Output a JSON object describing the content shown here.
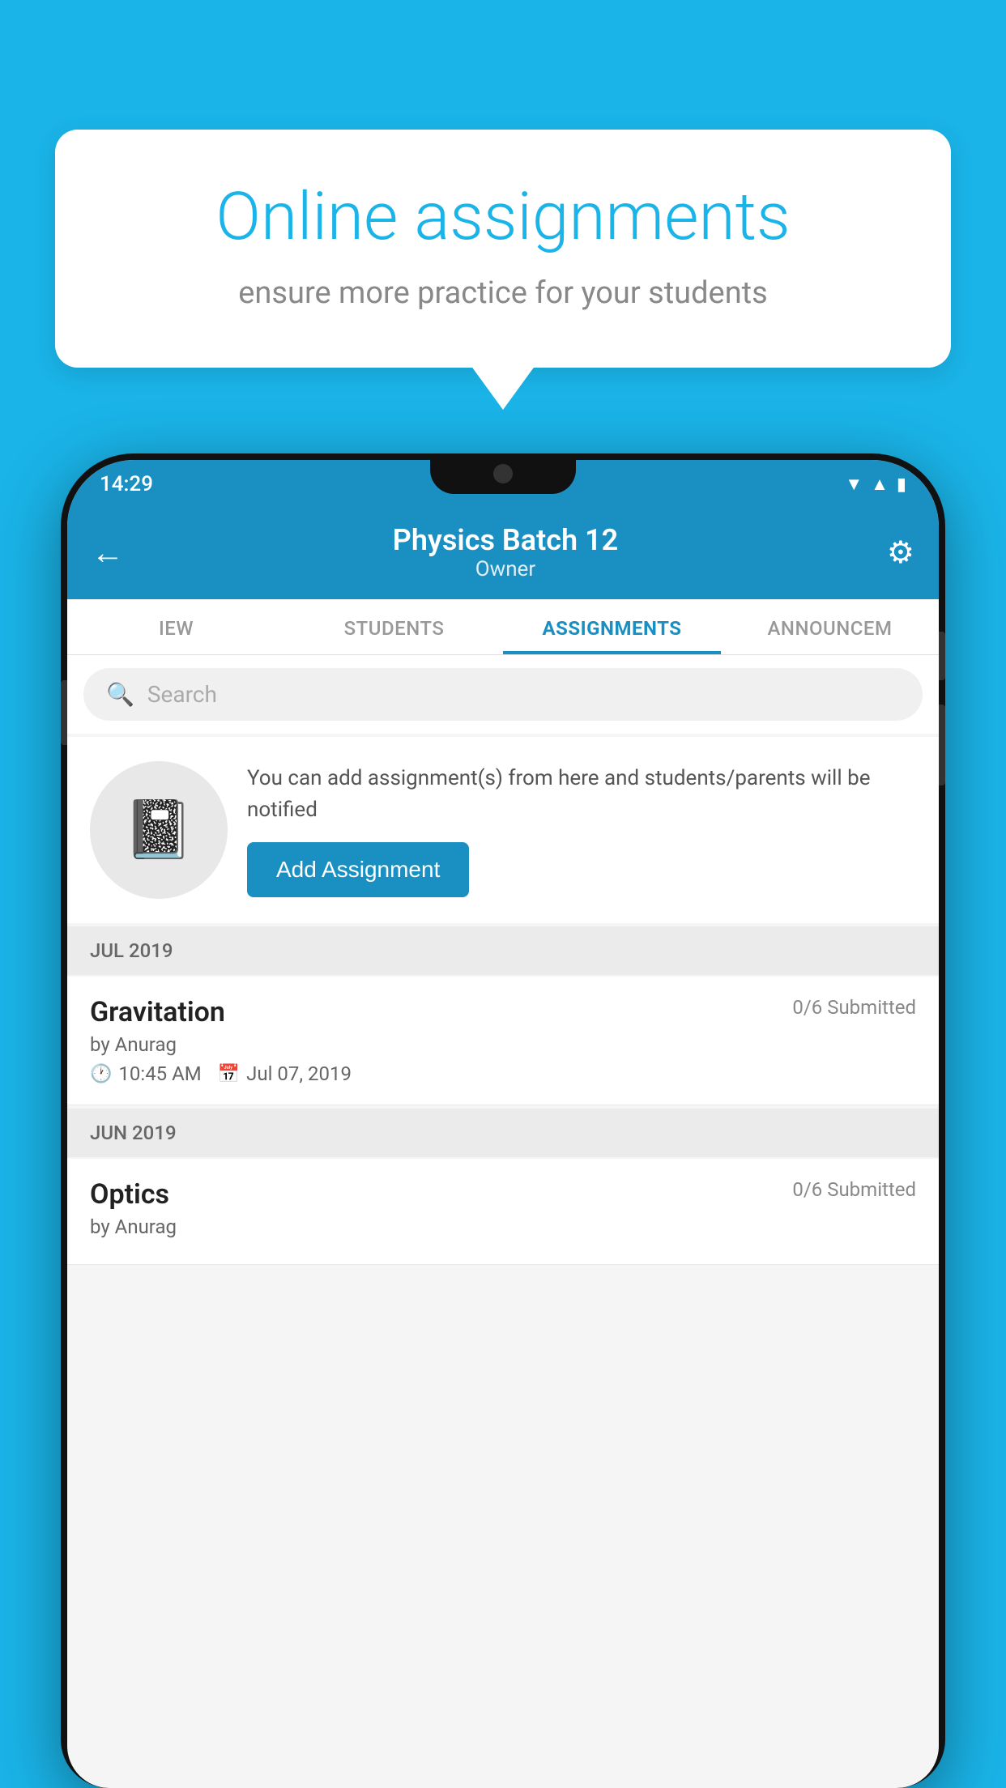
{
  "background": {
    "color": "#1ab4e8"
  },
  "speech_bubble": {
    "title": "Online assignments",
    "subtitle": "ensure more practice for your students"
  },
  "status_bar": {
    "time": "14:29",
    "icons": [
      "wifi",
      "signal",
      "battery"
    ]
  },
  "app_header": {
    "back_label": "←",
    "title": "Physics Batch 12",
    "subtitle": "Owner",
    "gear_label": "⚙"
  },
  "tabs": [
    {
      "label": "IEW",
      "active": false
    },
    {
      "label": "STUDENTS",
      "active": false
    },
    {
      "label": "ASSIGNMENTS",
      "active": true
    },
    {
      "label": "ANNOUNCEM",
      "active": false
    }
  ],
  "search": {
    "placeholder": "Search",
    "icon": "🔍"
  },
  "promo": {
    "icon": "📓",
    "text": "You can add assignment(s) from here and students/parents will be notified",
    "button_label": "Add Assignment"
  },
  "sections": [
    {
      "label": "JUL 2019",
      "assignments": [
        {
          "name": "Gravitation",
          "submitted": "0/6 Submitted",
          "by": "by Anurag",
          "time": "10:45 AM",
          "date": "Jul 07, 2019"
        }
      ]
    },
    {
      "label": "JUN 2019",
      "assignments": [
        {
          "name": "Optics",
          "submitted": "0/6 Submitted",
          "by": "by Anurag",
          "time": "",
          "date": ""
        }
      ]
    }
  ]
}
